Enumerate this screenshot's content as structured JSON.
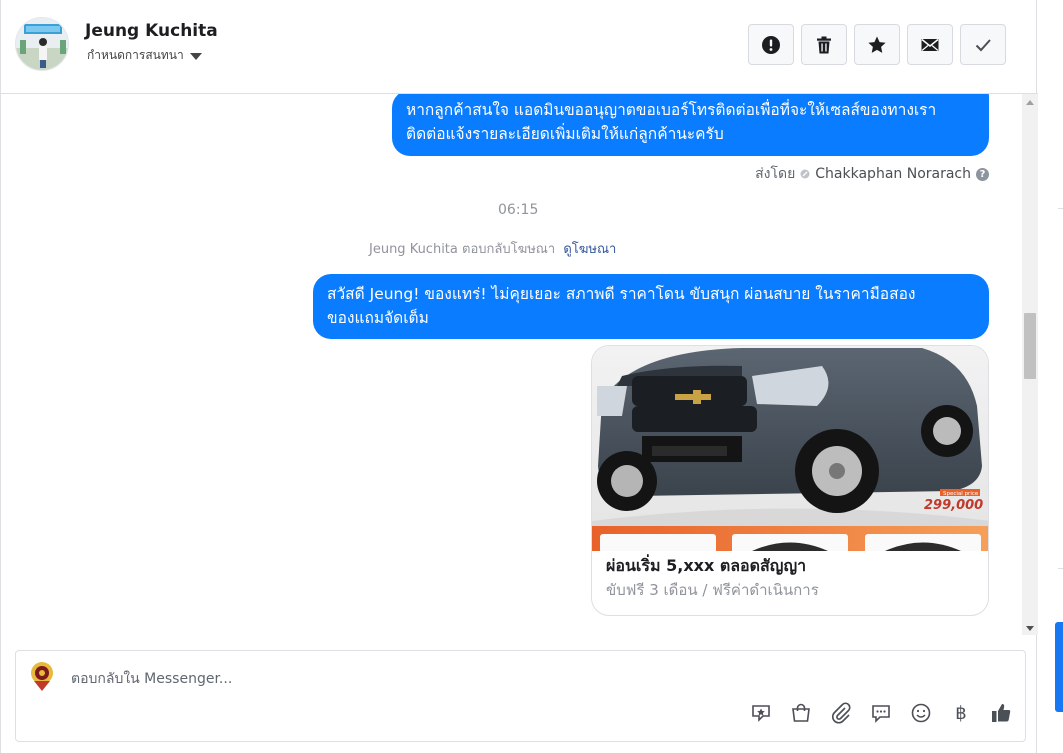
{
  "header": {
    "contact_name": "Jeung Kuchita",
    "subtitle": "กำหนดการสนทนา",
    "actions": [
      {
        "icon": "alert-icon"
      },
      {
        "icon": "trash-icon"
      },
      {
        "icon": "star-icon"
      },
      {
        "icon": "mail-icon"
      },
      {
        "icon": "check-icon"
      }
    ]
  },
  "thread": {
    "message1": {
      "line1": "หากลูกค้าสนใจ แอดมินขออนุญาตขอเบอร์โทรติดต่อเพื่อที่จะให้เซลส์ของทางเรา",
      "line2": "ติดต่อแจ้งรายละเอียดเพิ่มเติมให้แก่ลูกค้านะครับ"
    },
    "sent_by_label": "ส่งโดย",
    "sent_by_name": "Chakkaphan Norarach",
    "help_mark": "?",
    "time": "06:15",
    "reply_ad_text": "Jeung Kuchita ตอบกลับโฆษณา",
    "view_ad_link": "ดูโฆษณา",
    "message2": {
      "line1": "สวัสดี Jeung! ของแทร่! ไม่คุยเยอะ สภาพดี ราคาโดน ขับสนุก ผ่อนสบาย ในราคามือสอง",
      "line2": "ของแถมจัดเต็ม"
    },
    "card": {
      "price_tag": "299,000",
      "special": "Special price",
      "title": "ผ่อนเริ่ม 5,xxx ตลอดสัญญา",
      "subtitle": "ขับฟรี 3 เดือน / ฟรีค่าดำเนินการ"
    }
  },
  "composer": {
    "placeholder": "ตอบกลับใน Messenger...",
    "tools": [
      "sticker-icon",
      "shopping-bag-icon",
      "attachment-icon",
      "saved-replies-icon",
      "emoji-icon",
      "baht-icon",
      "like-icon"
    ],
    "baht_symbol": "฿"
  },
  "colors": {
    "bubble": "#0a7cff",
    "link": "#365899",
    "accent_right": "#1877f2"
  }
}
